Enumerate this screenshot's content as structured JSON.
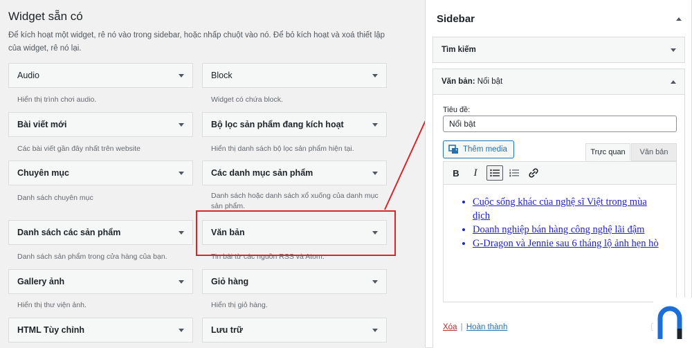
{
  "available": {
    "title": "Widget sẵn có",
    "description": "Để kích hoạt một widget, rê nó vào trong sidebar, hoặc nhấp chuột vào nó. Để bỏ kích hoạt và xoá thiết lập của widget, rê nó lại.",
    "widgets": [
      {
        "title": "Audio",
        "desc": "Hiển thị trình chơi audio."
      },
      {
        "title": "Block",
        "desc": "Widget có chứa block."
      },
      {
        "title": "Bài viết mới",
        "desc": "Các bài viết gần đây nhất trên website"
      },
      {
        "title": "Bộ lọc sản phẩm đang kích hoạt",
        "desc": "Hiển thị danh sách bộ lọc sản phẩm hiện tại."
      },
      {
        "title": "Chuyên mục",
        "desc": "Danh sách chuyên mục"
      },
      {
        "title": "Các danh mục sản phẩm",
        "desc": "Danh sách hoặc danh sách xổ xuống của danh mục sản phẩm."
      },
      {
        "title": "Danh sách các sản phẩm",
        "desc": "Danh sách sản phẩm trong cửa hàng của bạn."
      },
      {
        "title": "Văn bản",
        "desc": "Tin bài từ các nguồn RSS và Atom."
      },
      {
        "title": "Gallery ảnh",
        "desc": "Hiển thị thư viện ảnh."
      },
      {
        "title": "Giỏ hàng",
        "desc": "Hiển thị giỏ hàng."
      },
      {
        "title": "HTML Tùy chỉnh",
        "desc": ""
      },
      {
        "title": "Lưu trữ",
        "desc": ""
      }
    ]
  },
  "sidebar": {
    "title": "Sidebar",
    "search_widget": "Tìm kiếm",
    "text_widget_label": "Văn bản:",
    "text_widget_name": "Nổi bật",
    "field_label": "Tiêu đề:",
    "title_value": "Nổi bật",
    "add_media": "Thêm media",
    "tab_visual": "Trực quan",
    "tab_text": "Văn bản",
    "list_items": [
      "Cuộc sống khác của nghệ sĩ Việt trong mùa dịch",
      "Doanh nghiệp bán hàng công nghệ lãi đậm",
      "G-Dragon và Jennie sau 6 tháng lộ ảnh hẹn hò"
    ],
    "delete_link": "Xóa",
    "separator": "|",
    "done_link": "Hoàn thành"
  },
  "colors": {
    "highlight": "#d6262b",
    "link": "#2271b1",
    "delete": "#b32d2e"
  }
}
